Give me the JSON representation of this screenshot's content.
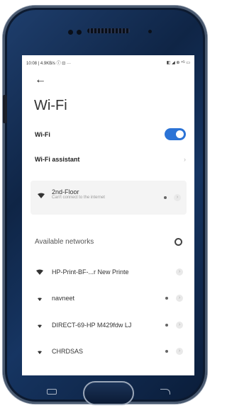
{
  "status": {
    "time": "10:08",
    "left_info": "10:08 | 4.9KB/s ⓘ ⊡ ···",
    "right_icons": "◧ ◢ ⊕ ⁴ᴳ ▭"
  },
  "header": {
    "back_icon": "arrow-left-icon",
    "title": "Wi-Fi"
  },
  "wifi_toggle": {
    "label": "Wi-Fi",
    "state": "on",
    "accent": "#2b73d6"
  },
  "wifi_assistant": {
    "label": "Wi-Fi assistant"
  },
  "saved_network": {
    "name": "2nd-Floor",
    "subtitle": "Can't connect to the internet"
  },
  "available": {
    "heading": "Available networks",
    "networks": [
      {
        "name": "HP-Print-BF-...r New Printe",
        "locked": false
      },
      {
        "name": "navneet",
        "locked": true
      },
      {
        "name": "DIRECT-69-HP M429fdw LJ",
        "locked": true
      },
      {
        "name": "CHRDSAS",
        "locked": true
      }
    ]
  }
}
